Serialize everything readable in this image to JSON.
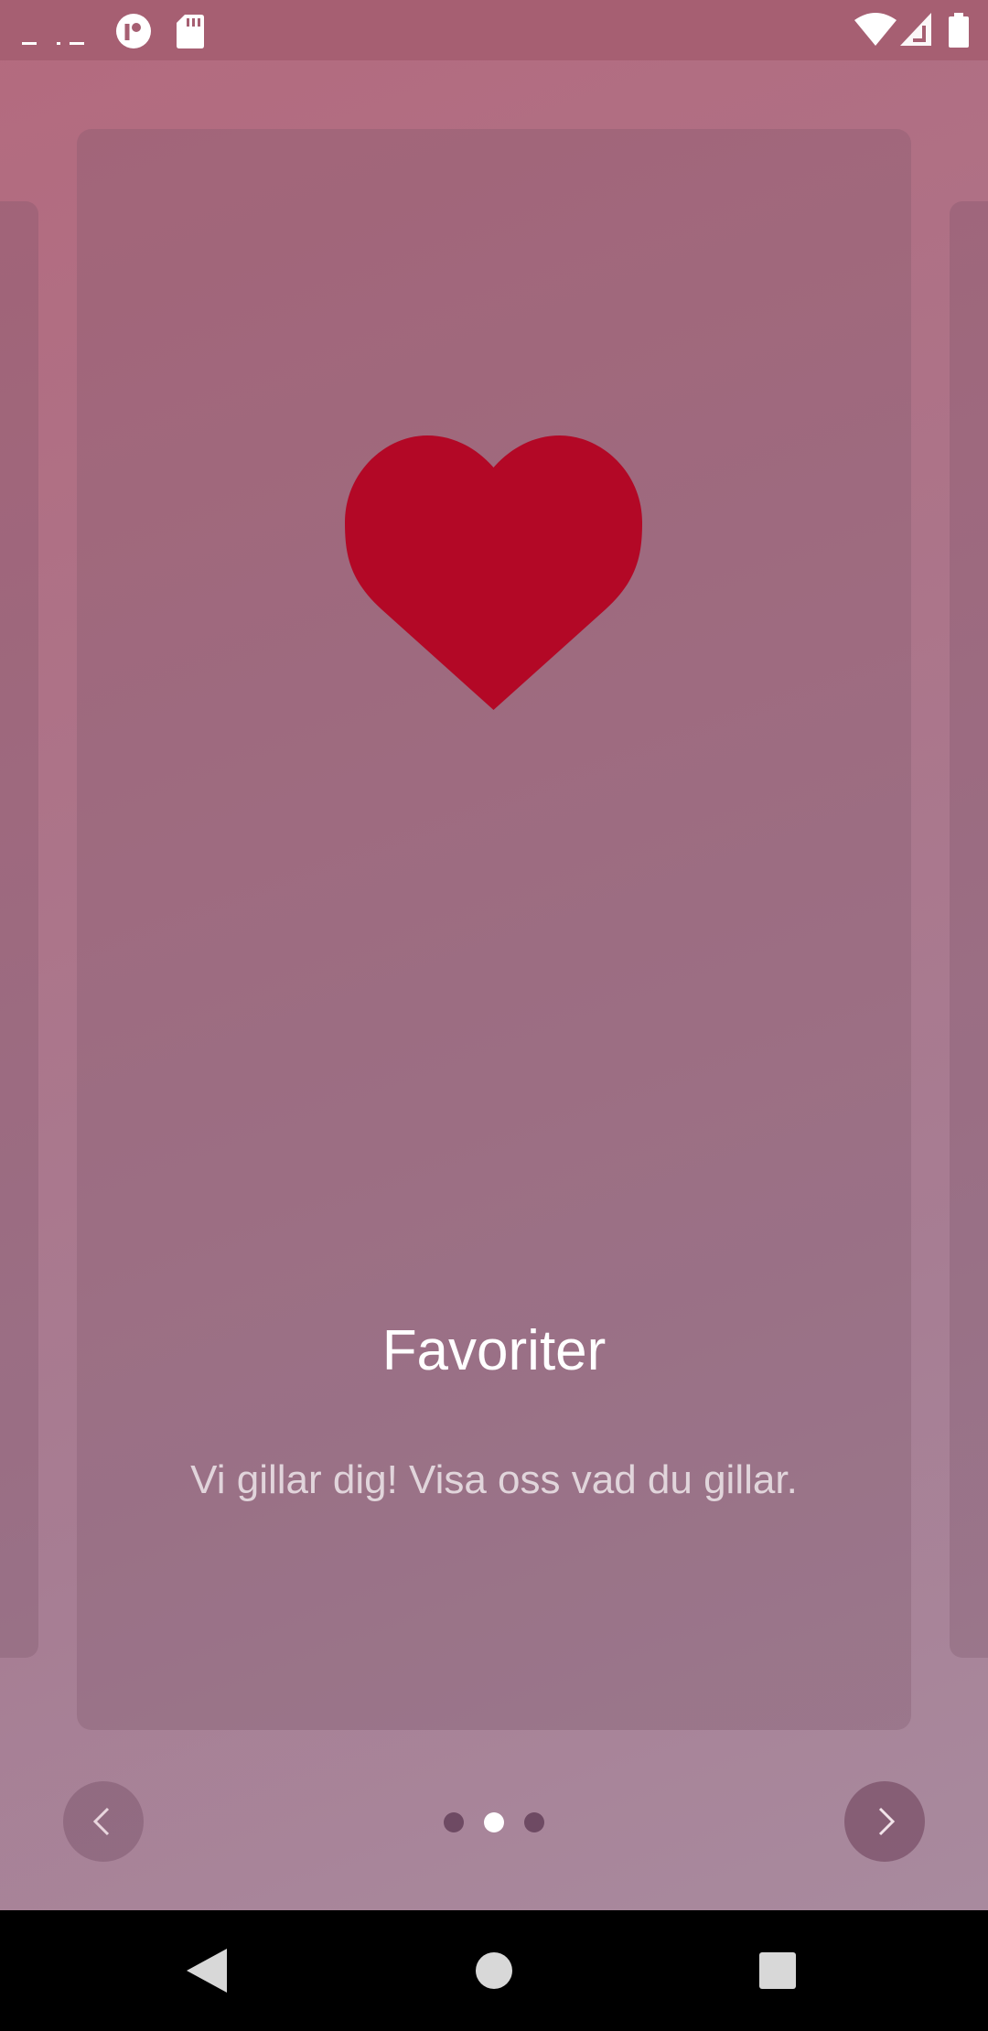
{
  "onboarding": {
    "title": "Favoriter",
    "description": "Vi gillar dig! Visa oss vad du gillar.",
    "current_page": 2,
    "total_pages": 3,
    "icon": "heart-icon"
  },
  "navigation": {
    "prev_icon": "chevron-left-icon",
    "next_icon": "chevron-right-icon"
  },
  "status_bar": {
    "icons": [
      "notification-icon",
      "app-icon",
      "sd-card-icon",
      "wifi-icon",
      "signal-icon",
      "battery-icon"
    ]
  },
  "system_nav": {
    "icons": [
      "back-icon",
      "home-icon",
      "recents-icon"
    ]
  },
  "colors": {
    "heart": "#b30826",
    "indicator_active": "#ffffff",
    "indicator_inactive": "#6e4a63"
  }
}
